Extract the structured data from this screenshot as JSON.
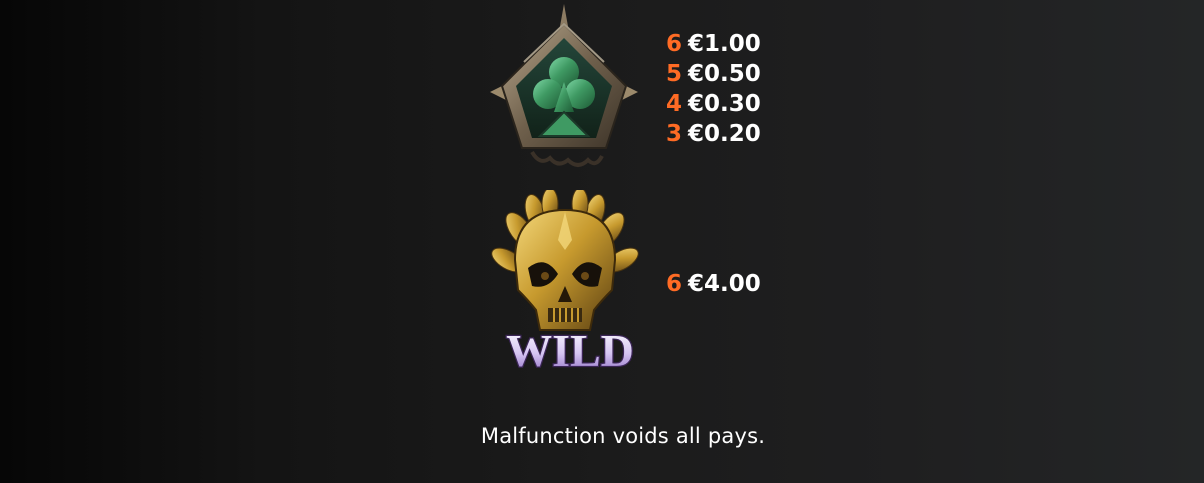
{
  "symbols": [
    {
      "id": "club",
      "icon": "green-club-gem-icon",
      "pays": [
        {
          "count": "6",
          "amount": "€1.00"
        },
        {
          "count": "5",
          "amount": "€0.50"
        },
        {
          "count": "4",
          "amount": "€0.30"
        },
        {
          "count": "3",
          "amount": "€0.20"
        }
      ]
    },
    {
      "id": "wild",
      "icon": "golden-skull-wild-icon",
      "logo_text": "WILD",
      "pays": [
        {
          "count": "6",
          "amount": "€4.00"
        }
      ]
    }
  ],
  "footer": {
    "disclaimer": "Malfunction voids all pays."
  },
  "colors": {
    "count": "#ff6b24",
    "amount": "#ffffff",
    "club_gem": "#3f9a63",
    "gold": "#c79a2e"
  }
}
